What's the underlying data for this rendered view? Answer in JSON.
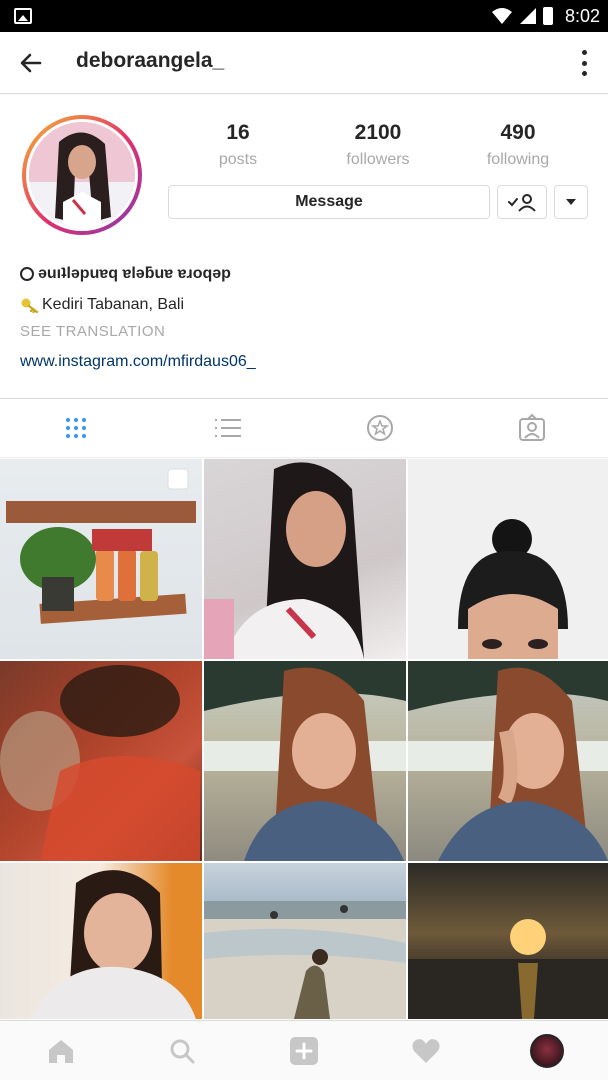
{
  "status_bar": {
    "time": "8:02"
  },
  "header": {
    "username": "deboraangela_"
  },
  "profile": {
    "stats": [
      {
        "value": "16",
        "label": "posts"
      },
      {
        "value": "2100",
        "label": "followers"
      },
      {
        "value": "490",
        "label": "following"
      }
    ],
    "message_label": "Message",
    "bio_name": "ǝuıʇlǝpuɐq ɐlǝƃuɐ ɐɹoqǝp",
    "bio_location": "Kediri Tabanan, Bali",
    "see_translation": "SEE TRANSLATION",
    "website": "www.instagram.com/mfirdaus06_"
  },
  "tabs": [
    "grid-icon",
    "list-icon",
    "saved-star-icon",
    "tagged-icon"
  ],
  "bottom_nav": [
    "home-icon",
    "search-icon",
    "add-icon",
    "heart-icon",
    "profile-avatar"
  ],
  "colors": {
    "link": "#003569",
    "muted": "#a8a8a8",
    "accent_active": "#3897f0",
    "text": "#262626"
  }
}
